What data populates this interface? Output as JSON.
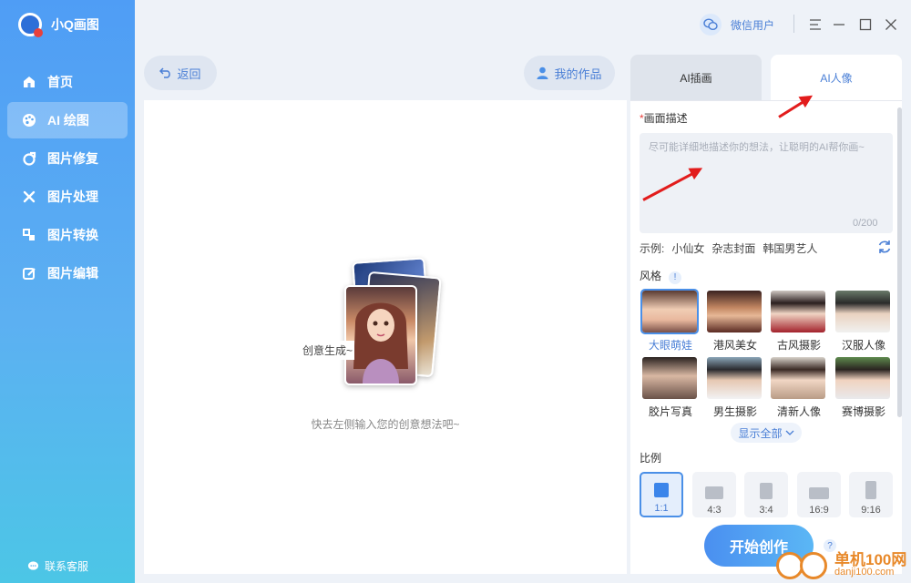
{
  "app": {
    "name": "小Q画图"
  },
  "titlebar": {
    "user_name": "微信用户"
  },
  "sidebar": {
    "items": [
      {
        "label": "首页",
        "icon": "home-icon"
      },
      {
        "label": "AI 绘图",
        "icon": "palette-icon",
        "active": true
      },
      {
        "label": "图片修复",
        "icon": "repair-icon"
      },
      {
        "label": "图片处理",
        "icon": "tools-icon"
      },
      {
        "label": "图片转换",
        "icon": "convert-icon"
      },
      {
        "label": "图片编辑",
        "icon": "edit-icon"
      }
    ],
    "service_label": "联系客服"
  },
  "toolbar": {
    "back_label": "返回",
    "works_label": "我的作品"
  },
  "canvas": {
    "create_label": "创意生成~",
    "hint": "快去左侧输入您的创意想法吧~"
  },
  "tabs": [
    {
      "label": "AI插画"
    },
    {
      "label": "AI人像",
      "active": true
    }
  ],
  "form": {
    "desc_label": "画面描述",
    "desc_required_mark": "*",
    "desc_placeholder": "尽可能详细地描述你的想法，让聪明的AI帮你画~",
    "desc_value": "",
    "counter": "0/200",
    "examples_prefix": "示例:",
    "examples": [
      "小仙女",
      "杂志封面",
      "韩国男艺人"
    ],
    "style_label": "风格",
    "style_info": "!",
    "styles": [
      {
        "name": "大眼萌娃",
        "selected": true
      },
      {
        "name": "港风美女"
      },
      {
        "name": "古风摄影"
      },
      {
        "name": "汉服人像"
      },
      {
        "name": "胶片写真"
      },
      {
        "name": "男生摄影"
      },
      {
        "name": "清新人像"
      },
      {
        "name": "赛博摄影"
      }
    ],
    "show_all_label": "显示全部",
    "ratio_label": "比例",
    "ratios": [
      {
        "label": "1:1",
        "selected": true
      },
      {
        "label": "4:3"
      },
      {
        "label": "3:4"
      },
      {
        "label": "16:9"
      },
      {
        "label": "9:16"
      }
    ],
    "start_label": "开始创作",
    "help_mark": "?"
  },
  "watermark": {
    "title": "单机100网",
    "url": "danji100.com"
  },
  "colors": {
    "accent": "#4a7fd6",
    "sidebar_top": "#4f9df5",
    "sidebar_bottom": "#4cc6e6",
    "arrow": "#e21c1c"
  }
}
